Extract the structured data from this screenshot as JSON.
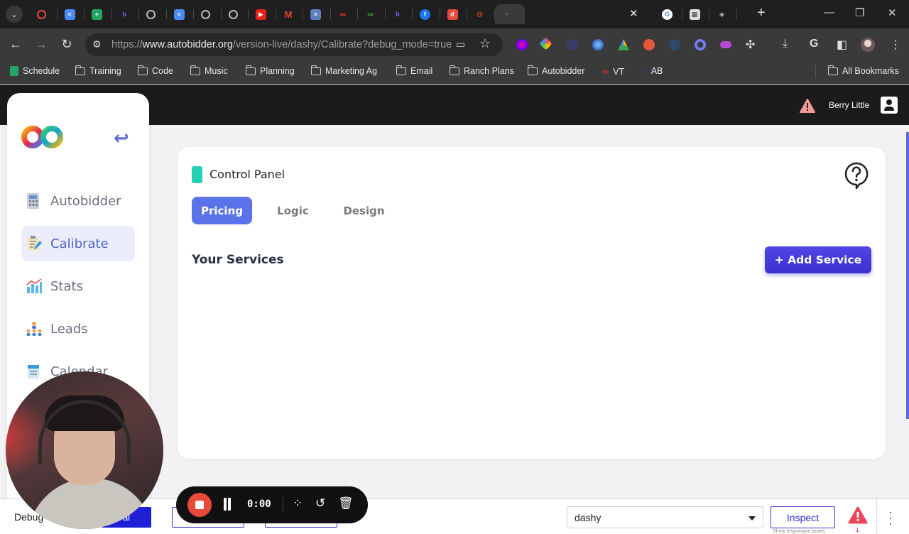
{
  "browser": {
    "url_domain": "www.autobidder.org",
    "url_path": "/version-live/dashy/Calibrate?debug_mode=true",
    "url_prefix": "https://",
    "bookmarks": [
      {
        "label": "Schedule",
        "icon": "sheets-icon"
      },
      {
        "label": "Training",
        "icon": "folder-icon"
      },
      {
        "label": "Code",
        "icon": "folder-icon"
      },
      {
        "label": "Music",
        "icon": "folder-icon"
      },
      {
        "label": "Planning",
        "icon": "folder-icon"
      },
      {
        "label": "Marketing Ag",
        "icon": "folder-icon"
      },
      {
        "label": "Email",
        "icon": "folder-icon"
      },
      {
        "label": "Ranch Plans",
        "icon": "folder-icon"
      },
      {
        "label": "Autobidder",
        "icon": "folder-icon"
      },
      {
        "label": "VT",
        "icon": "infinity-icon"
      },
      {
        "label": "AB",
        "icon": "ab-icon"
      }
    ],
    "all_bookmarks": "All Bookmarks"
  },
  "header": {
    "user_name": "Berry Little"
  },
  "sidebar": {
    "items": [
      {
        "label": "Autobidder",
        "active": false
      },
      {
        "label": "Calibrate",
        "active": true
      },
      {
        "label": "Stats",
        "active": false
      },
      {
        "label": "Leads",
        "active": false
      },
      {
        "label": "Calendar",
        "active": false
      }
    ]
  },
  "main": {
    "title": "Control Panel",
    "tabs": [
      {
        "label": "Pricing",
        "active": true
      },
      {
        "label": "Logic",
        "active": false
      },
      {
        "label": "Design",
        "active": false
      }
    ],
    "section_title": "Your Services",
    "add_button": "+ Add Service"
  },
  "debug": {
    "label": "Debug",
    "blue_button": "al",
    "app_select_value": "dashy",
    "inspect_label": "Inspect",
    "inspect_sub": "Show responsive boxes",
    "warning_count": "1"
  },
  "recorder": {
    "time": "0:00"
  },
  "colors": {
    "accent": "#22d3b6",
    "primary": "#5b73e8",
    "add_button": "#4f46e5",
    "warning": "#e8475a"
  }
}
